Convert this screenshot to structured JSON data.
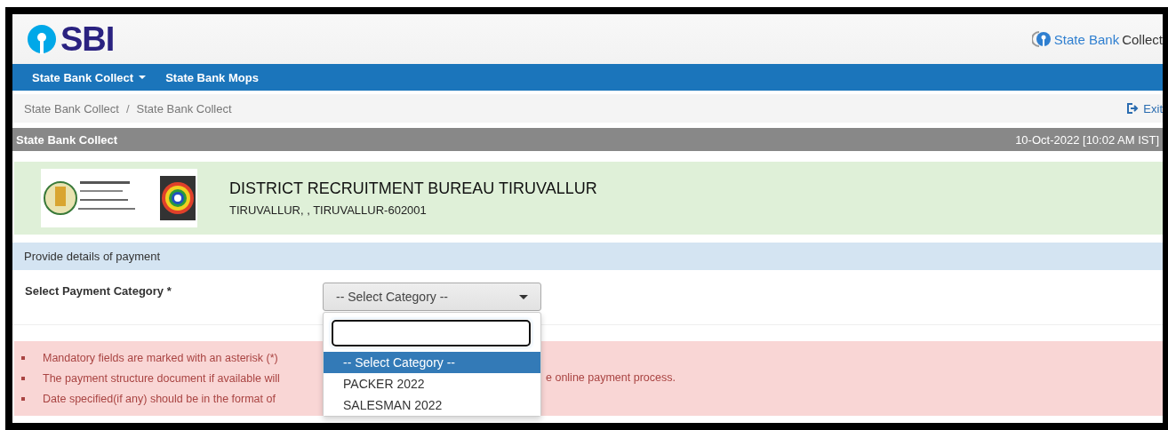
{
  "header": {
    "logo_text": "SBI",
    "brand_link": {
      "part1": "State Bank",
      "part2": "Collect"
    }
  },
  "navbar": {
    "items": [
      {
        "label": "State Bank Collect",
        "has_menu": true
      },
      {
        "label": "State Bank Mops",
        "has_menu": false
      }
    ]
  },
  "breadcrumb": {
    "items": [
      "State Bank Collect",
      "State Bank Collect"
    ],
    "separator": "/",
    "exit": "Exit"
  },
  "title_bar": {
    "title": "State Bank Collect",
    "datetime": "10-Oct-2022 [10:02 AM IST]"
  },
  "institution": {
    "name": "DISTRICT RECRUITMENT BUREAU TIRUVALLUR",
    "address": "TIRUVALLUR, , TIRUVALLUR-602001"
  },
  "section_heading": "Provide details of payment",
  "form": {
    "label": "Select Payment Category *",
    "select": {
      "value": "-- Select Category --",
      "expanded": true,
      "options": [
        {
          "label": "-- Select Category --",
          "selected": true
        },
        {
          "label": "PACKER 2022",
          "selected": false
        },
        {
          "label": "SALESMAN 2022",
          "selected": false
        }
      ]
    }
  },
  "notes": [
    {
      "parts": [
        "Mandatory fields are marked with an asterisk (*)"
      ]
    },
    {
      "parts": [
        "The payment structure document if available will",
        "e online payment process."
      ]
    },
    {
      "parts": [
        "Date specified(if any) should be in the format of"
      ]
    }
  ]
}
